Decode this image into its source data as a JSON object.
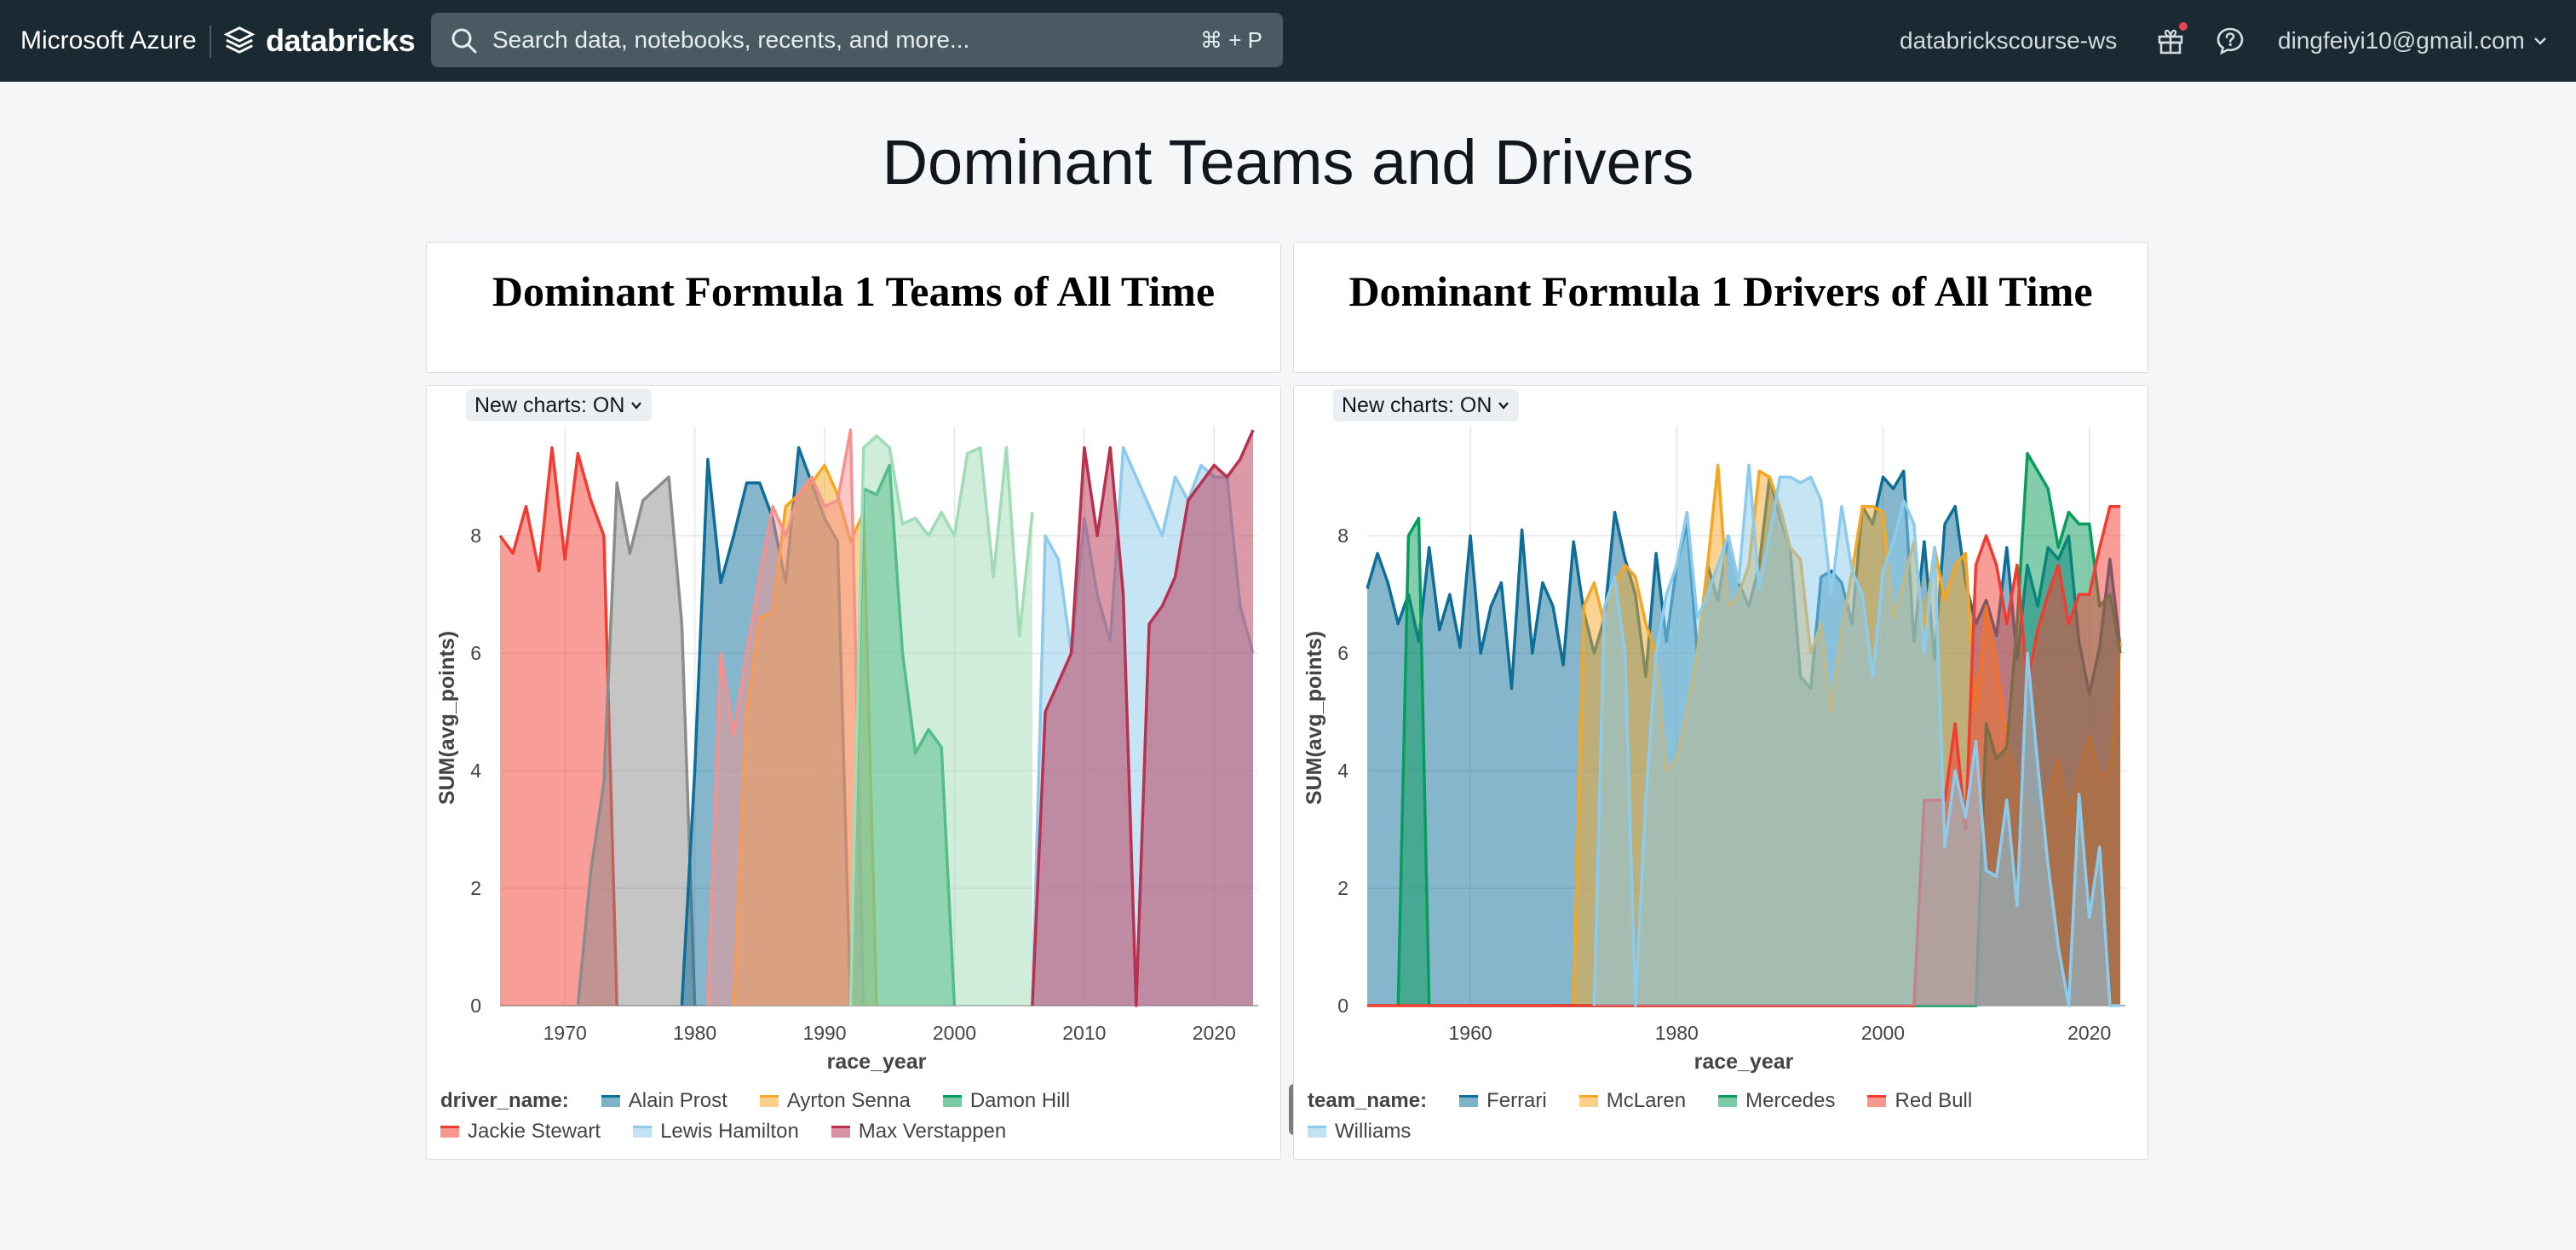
{
  "topbar": {
    "brand_ms": "Microsoft Azure",
    "brand_db": "databricks",
    "search_placeholder": "Search data, notebooks, recents, and more...",
    "search_shortcut": "⌘ + P",
    "workspace": "databrickscourse-ws",
    "user_email": "dingfeiyi10@gmail.com"
  },
  "dashboard": {
    "title": "Dominant Teams and Drivers",
    "tile_left_title": "Dominant Formula 1 Teams of All Time",
    "tile_right_title": "Dominant Formula 1 Drivers of All Time",
    "new_charts_toggle": "New charts: ON"
  },
  "colors": {
    "blue": "#0e6e98",
    "orange": "#f5a623",
    "green": "#089c5c",
    "red": "#f23c2f",
    "lightblue": "#8ccbeb",
    "crimson": "#b8324f",
    "gray": "#8c8c8c",
    "pink": "#f5918e"
  },
  "chart_data": [
    {
      "type": "area",
      "xlabel": "race_year",
      "ylabel": "SUM(avg_points)",
      "xlim": [
        1965,
        2023
      ],
      "ylim": [
        0,
        9.8
      ],
      "xticks": [
        "1970",
        "1980",
        "1990",
        "2000",
        "2010",
        "2020"
      ],
      "yticks": [
        "0",
        "2",
        "4",
        "6",
        "8"
      ],
      "legend_title": "driver_name:",
      "series": [
        {
          "name": "Jackie Stewart",
          "color": "#f23c2f",
          "x": [
            1965,
            1966,
            1967,
            1968,
            1969,
            1970,
            1971,
            1972,
            1973,
            1974
          ],
          "y": [
            8.0,
            7.7,
            8.5,
            7.4,
            9.5,
            7.6,
            9.4,
            8.6,
            8.0,
            0
          ]
        },
        {
          "name": "",
          "color": "#8c8c8c",
          "x": [
            1971,
            1972,
            1973,
            1974,
            1975,
            1976,
            1977,
            1978,
            1979,
            1980
          ],
          "y": [
            0,
            2.3,
            3.8,
            8.9,
            7.7,
            8.6,
            8.8,
            9.0,
            6.5,
            0
          ]
        },
        {
          "name": "Alain Prost",
          "color": "#0e6e98",
          "x": [
            1979,
            1980,
            1981,
            1982,
            1983,
            1984,
            1985,
            1986,
            1987,
            1988,
            1989,
            1990,
            1991,
            1992
          ],
          "y": [
            0,
            4.0,
            9.3,
            7.2,
            8.0,
            8.9,
            8.9,
            8.3,
            7.2,
            9.5,
            8.9,
            8.3,
            7.9,
            0
          ]
        },
        {
          "name": "Ayrton Senna",
          "color": "#f5a623",
          "x": [
            1983,
            1984,
            1985,
            1986,
            1987,
            1988,
            1989,
            1990,
            1991,
            1992,
            1993,
            1994
          ],
          "y": [
            0,
            5.0,
            6.6,
            6.7,
            8.5,
            8.7,
            8.9,
            9.2,
            8.7,
            7.9,
            8.4,
            0
          ]
        },
        {
          "name": "",
          "color": "#f5918e",
          "x": [
            1981,
            1982,
            1983,
            1984,
            1985,
            1986,
            1987,
            1988,
            1989,
            1990,
            1991,
            1992,
            1993
          ],
          "y": [
            0,
            6.0,
            4.6,
            6.0,
            7.3,
            8.5,
            8.0,
            8.7,
            9.0,
            8.5,
            8.6,
            9.8,
            0
          ]
        },
        {
          "name": "Damon Hill",
          "color": "#089c5c",
          "x": [
            1992,
            1993,
            1994,
            1995,
            1996,
            1997,
            1998,
            1999,
            2000
          ],
          "y": [
            0,
            8.8,
            8.7,
            9.2,
            6.0,
            4.3,
            4.7,
            4.4,
            0
          ]
        },
        {
          "name": "",
          "color": "#a0dcb6",
          "x": [
            1992,
            1993,
            1994,
            1995,
            1996,
            1997,
            1998,
            1999,
            2000,
            2001,
            2002,
            2003,
            2004,
            2005,
            2006
          ],
          "y": [
            0,
            9.5,
            9.7,
            9.5,
            8.2,
            8.3,
            8.0,
            8.4,
            8.0,
            9.4,
            9.5,
            7.3,
            9.5,
            6.3,
            8.4
          ]
        },
        {
          "name": "Lewis Hamilton",
          "color": "#8ccbeb",
          "x": [
            2006,
            2007,
            2008,
            2009,
            2010,
            2011,
            2012,
            2013,
            2014,
            2015,
            2016,
            2017,
            2018,
            2019,
            2020,
            2021,
            2022,
            2023
          ],
          "y": [
            0,
            8.0,
            7.6,
            6.0,
            8.3,
            7.0,
            6.2,
            9.5,
            9.0,
            8.5,
            8.0,
            9.0,
            8.6,
            9.2,
            9.0,
            9.0,
            6.8,
            6.0
          ]
        },
        {
          "name": "Max Verstappen",
          "color": "#b8324f",
          "x": [
            2006,
            2007,
            2008,
            2009,
            2010,
            2011,
            2012,
            2013,
            2014,
            2015,
            2016,
            2017,
            2018,
            2019,
            2020,
            2021,
            2022,
            2023
          ],
          "y": [
            0,
            5.0,
            5.5,
            6.0,
            9.5,
            8.0,
            9.5,
            7.0,
            0,
            6.5,
            6.8,
            7.3,
            8.6,
            8.9,
            9.2,
            9.0,
            9.3,
            9.8
          ]
        }
      ]
    },
    {
      "type": "area",
      "xlabel": "race_year",
      "ylabel": "SUM(avg_points)",
      "xlim": [
        1950,
        2023
      ],
      "ylim": [
        0,
        9.8
      ],
      "xticks": [
        "1960",
        "1980",
        "2000",
        "2020"
      ],
      "yticks": [
        "0",
        "2",
        "4",
        "6",
        "8"
      ],
      "legend_title": "team_name:",
      "series": [
        {
          "name": "Ferrari",
          "color": "#0e6e98",
          "x": [
            1950,
            1951,
            1952,
            1953,
            1954,
            1955,
            1956,
            1957,
            1958,
            1959,
            1960,
            1961,
            1962,
            1963,
            1964,
            1965,
            1966,
            1967,
            1968,
            1969,
            1970,
            1971,
            1972,
            1973,
            1974,
            1975,
            1976,
            1977,
            1978,
            1979,
            1980,
            1981,
            1982,
            1983,
            1984,
            1985,
            1986,
            1987,
            1988,
            1989,
            1990,
            1991,
            1992,
            1993,
            1994,
            1995,
            1996,
            1997,
            1998,
            1999,
            2000,
            2001,
            2002,
            2003,
            2004,
            2005,
            2006,
            2007,
            2008,
            2009,
            2010,
            2011,
            2012,
            2013,
            2014,
            2015,
            2016,
            2017,
            2018,
            2019,
            2020,
            2021,
            2022,
            2023
          ],
          "y": [
            7.1,
            7.7,
            7.2,
            6.5,
            7.0,
            6.2,
            7.8,
            6.4,
            7.0,
            6.1,
            8.0,
            6.0,
            6.8,
            7.2,
            5.4,
            8.1,
            6.0,
            7.2,
            6.8,
            5.8,
            7.9,
            6.7,
            6.0,
            6.6,
            8.4,
            7.6,
            7.0,
            5.6,
            7.7,
            6.2,
            7.5,
            8.2,
            6.0,
            7.5,
            6.9,
            8.0,
            7.2,
            6.8,
            7.5,
            9.0,
            8.3,
            7.8,
            5.6,
            5.4,
            7.3,
            7.4,
            7.2,
            6.5,
            8.5,
            8.2,
            9.0,
            8.8,
            9.1,
            6.2,
            7.9,
            5.9,
            8.2,
            8.5,
            7.2,
            6.5,
            6.9,
            6.3,
            7.8,
            5.9,
            7.5,
            6.8,
            7.8,
            7.6,
            8.0,
            6.2,
            5.3,
            6.1,
            7.6,
            6.1
          ]
        },
        {
          "name": "McLaren",
          "color": "#f5a623",
          "x": [
            1969,
            1970,
            1971,
            1972,
            1973,
            1974,
            1975,
            1976,
            1977,
            1978,
            1979,
            1980,
            1981,
            1982,
            1983,
            1984,
            1985,
            1986,
            1987,
            1988,
            1989,
            1990,
            1991,
            1992,
            1993,
            1994,
            1995,
            1996,
            1997,
            1998,
            1999,
            2000,
            2001,
            2002,
            2003,
            2004,
            2005,
            2006,
            2007,
            2008,
            2009,
            2010,
            2011,
            2012,
            2013,
            2014,
            2015,
            2016,
            2017,
            2018,
            2019,
            2020,
            2021,
            2022,
            2023
          ],
          "y": [
            0,
            0,
            6.8,
            7.2,
            6.5,
            7.2,
            7.5,
            7.3,
            6.5,
            6.0,
            4.0,
            4.2,
            5.0,
            6.0,
            7.5,
            9.2,
            6.8,
            7.0,
            7.5,
            9.1,
            9.0,
            8.5,
            7.8,
            7.6,
            6.0,
            6.5,
            5.0,
            6.4,
            7.4,
            8.5,
            8.5,
            8.4,
            6.6,
            7.2,
            7.9,
            6.4,
            7.8,
            6.9,
            7.5,
            7.7,
            5.0,
            6.8,
            5.8,
            4.5,
            3.8,
            3.5,
            3.0,
            3.6,
            4.2,
            3.2,
            4.0,
            4.6,
            3.9,
            4.0,
            6.2
          ]
        },
        {
          "name": "Mercedes",
          "color": "#089c5c",
          "x": [
            1953,
            1954,
            1955,
            1956,
            2009,
            2010,
            2011,
            2012,
            2013,
            2014,
            2015,
            2016,
            2017,
            2018,
            2019,
            2020,
            2021,
            2022,
            2023
          ],
          "y": [
            0,
            8.0,
            8.3,
            0,
            0,
            4.8,
            4.2,
            4.4,
            6.5,
            9.4,
            9.1,
            8.8,
            7.8,
            8.4,
            8.2,
            8.2,
            6.8,
            7.0,
            6.0
          ]
        },
        {
          "name": "Red Bull",
          "color": "#f23c2f",
          "x": [
            1950,
            2003,
            2004,
            2005,
            2006,
            2007,
            2008,
            2009,
            2010,
            2011,
            2012,
            2013,
            2014,
            2015,
            2016,
            2017,
            2018,
            2019,
            2020,
            2021,
            2022,
            2023
          ],
          "y": [
            0,
            0,
            3.5,
            3.5,
            3.5,
            4.8,
            3.0,
            7.5,
            8.0,
            7.5,
            6.5,
            7.5,
            5.5,
            6.4,
            7.0,
            7.5,
            6.5,
            7.0,
            7.0,
            7.8,
            8.5,
            8.5
          ]
        },
        {
          "name": "Williams",
          "color": "#8ccbeb",
          "x": [
            1972,
            1973,
            1974,
            1975,
            1976,
            1977,
            1978,
            1979,
            1980,
            1981,
            1982,
            1983,
            1984,
            1985,
            1986,
            1987,
            1988,
            1989,
            1990,
            1991,
            1992,
            1993,
            1994,
            1995,
            1996,
            1997,
            1998,
            1999,
            2000,
            2001,
            2002,
            2003,
            2004,
            2005,
            2006,
            2007,
            2008,
            2009,
            2010,
            2011,
            2012,
            2013,
            2014,
            2015,
            2016,
            2017,
            2018,
            2019,
            2020,
            2021,
            2022,
            2023
          ],
          "y": [
            0,
            6.8,
            7.3,
            6.0,
            0,
            3.5,
            6.0,
            7.0,
            7.5,
            8.4,
            6.6,
            7.0,
            7.5,
            8.0,
            7.2,
            9.2,
            7.1,
            8.0,
            9.0,
            9.0,
            8.9,
            9.0,
            8.6,
            7.0,
            8.5,
            7.4,
            7.0,
            5.6,
            7.4,
            7.9,
            8.6,
            8.2,
            6.0,
            7.8,
            2.7,
            4.0,
            3.2,
            4.5,
            2.3,
            2.2,
            3.5,
            1.7,
            6.0,
            4.1,
            2.4,
            1.0,
            0,
            3.6,
            1.5,
            2.7,
            0,
            0
          ]
        }
      ]
    }
  ],
  "legend_left": {
    "title": "driver_name:",
    "items": [
      {
        "label": "Alain Prost",
        "color": "#0e6e98"
      },
      {
        "label": "Ayrton Senna",
        "color": "#f5a623"
      },
      {
        "label": "Damon Hill",
        "color": "#089c5c"
      },
      {
        "label": "Jackie Stewart",
        "color": "#f23c2f"
      },
      {
        "label": "Lewis Hamilton",
        "color": "#8ccbeb"
      },
      {
        "label": "Max Verstappen",
        "color": "#b8324f"
      }
    ]
  },
  "legend_right": {
    "title": "team_name:",
    "items": [
      {
        "label": "Ferrari",
        "color": "#0e6e98"
      },
      {
        "label": "McLaren",
        "color": "#f5a623"
      },
      {
        "label": "Mercedes",
        "color": "#089c5c"
      },
      {
        "label": "Red Bull",
        "color": "#f23c2f"
      },
      {
        "label": "Williams",
        "color": "#8ccbeb"
      }
    ]
  }
}
